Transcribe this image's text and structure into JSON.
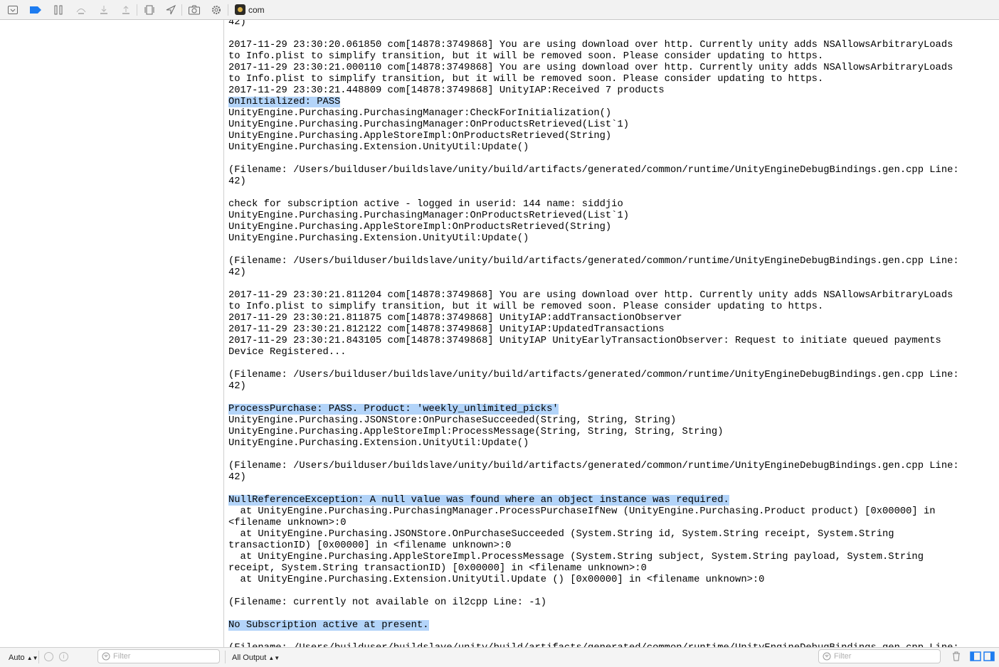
{
  "toolbar": {
    "app_name": "com",
    "icons": [
      "hide-debug-area-icon",
      "breakpoints-toggle-icon",
      "pause-icon",
      "step-over-icon",
      "step-into-icon",
      "step-out-icon",
      "view-hierarchy-icon",
      "location-icon",
      "camera-icon",
      "gear-icon"
    ]
  },
  "console": {
    "lines": [
      "42)",
      "",
      "2017-11-29 23:30:20.061850 com[14878:3749868] You are using download over http. Currently unity adds NSAllowsArbitraryLoads",
      "to Info.plist to simplify transition, but it will be removed soon. Please consider updating to https.",
      "2017-11-29 23:30:21.000110 com[14878:3749868] You are using download over http. Currently unity adds NSAllowsArbitraryLoads",
      "to Info.plist to simplify transition, but it will be removed soon. Please consider updating to https.",
      "2017-11-29 23:30:21.448809 com[14878:3749868] UnityIAP:Received 7 products",
      "OnInitialized: PASS",
      "UnityEngine.Purchasing.PurchasingManager:CheckForInitialization()",
      "UnityEngine.Purchasing.PurchasingManager:OnProductsRetrieved(List`1)",
      "UnityEngine.Purchasing.AppleStoreImpl:OnProductsRetrieved(String)",
      "UnityEngine.Purchasing.Extension.UnityUtil:Update()",
      "",
      "(Filename: /Users/builduser/buildslave/unity/build/artifacts/generated/common/runtime/UnityEngineDebugBindings.gen.cpp Line:",
      "42)",
      "",
      "check for subscription active - logged in userid: 144 name: siddjio",
      "UnityEngine.Purchasing.PurchasingManager:OnProductsRetrieved(List`1)",
      "UnityEngine.Purchasing.AppleStoreImpl:OnProductsRetrieved(String)",
      "UnityEngine.Purchasing.Extension.UnityUtil:Update()",
      "",
      "(Filename: /Users/builduser/buildslave/unity/build/artifacts/generated/common/runtime/UnityEngineDebugBindings.gen.cpp Line:",
      "42)",
      "",
      "2017-11-29 23:30:21.811204 com[14878:3749868] You are using download over http. Currently unity adds NSAllowsArbitraryLoads",
      "to Info.plist to simplify transition, but it will be removed soon. Please consider updating to https.",
      "2017-11-29 23:30:21.811875 com[14878:3749868] UnityIAP:addTransactionObserver",
      "2017-11-29 23:30:21.812122 com[14878:3749868] UnityIAP:UpdatedTransactions",
      "2017-11-29 23:30:21.843105 com[14878:3749868] UnityIAP UnityEarlyTransactionObserver: Request to initiate queued payments",
      "Device Registered...",
      "",
      "(Filename: /Users/builduser/buildslave/unity/build/artifacts/generated/common/runtime/UnityEngineDebugBindings.gen.cpp Line:",
      "42)",
      "",
      "ProcessPurchase: PASS. Product: 'weekly_unlimited_picks'",
      "UnityEngine.Purchasing.JSONStore:OnPurchaseSucceeded(String, String, String)",
      "UnityEngine.Purchasing.AppleStoreImpl:ProcessMessage(String, String, String, String)",
      "UnityEngine.Purchasing.Extension.UnityUtil:Update()",
      "",
      "(Filename: /Users/builduser/buildslave/unity/build/artifacts/generated/common/runtime/UnityEngineDebugBindings.gen.cpp Line:",
      "42)",
      "",
      "NullReferenceException: A null value was found where an object instance was required.",
      "  at UnityEngine.Purchasing.PurchasingManager.ProcessPurchaseIfNew (UnityEngine.Purchasing.Product product) [0x00000] in",
      "<filename unknown>:0",
      "  at UnityEngine.Purchasing.JSONStore.OnPurchaseSucceeded (System.String id, System.String receipt, System.String",
      "transactionID) [0x00000] in <filename unknown>:0",
      "  at UnityEngine.Purchasing.AppleStoreImpl.ProcessMessage (System.String subject, System.String payload, System.String",
      "receipt, System.String transactionID) [0x00000] in <filename unknown>:0",
      "  at UnityEngine.Purchasing.Extension.UnityUtil.Update () [0x00000] in <filename unknown>:0",
      "",
      "(Filename: currently not available on il2cpp Line: -1)",
      "",
      "No Subscription active at present.",
      "",
      "(Filename: /Users/builduser/buildslave/unity/build/artifacts/generated/common/runtime/UnityEngineDebugBindings.gen.cpp Line:"
    ],
    "highlighted": [
      "OnInitialized: PASS",
      "ProcessPurchase: PASS. Product: 'weekly_unlimited_picks'",
      "NullReferenceException: A null value was found where an object instance was required.",
      "No Subscription active at present."
    ],
    "highlight_color": "#b3d4f9"
  },
  "bottom_bar": {
    "scope_label": "Auto",
    "left_filter_placeholder": "Filter",
    "output_label": "All Output",
    "right_filter_placeholder": "Filter"
  }
}
